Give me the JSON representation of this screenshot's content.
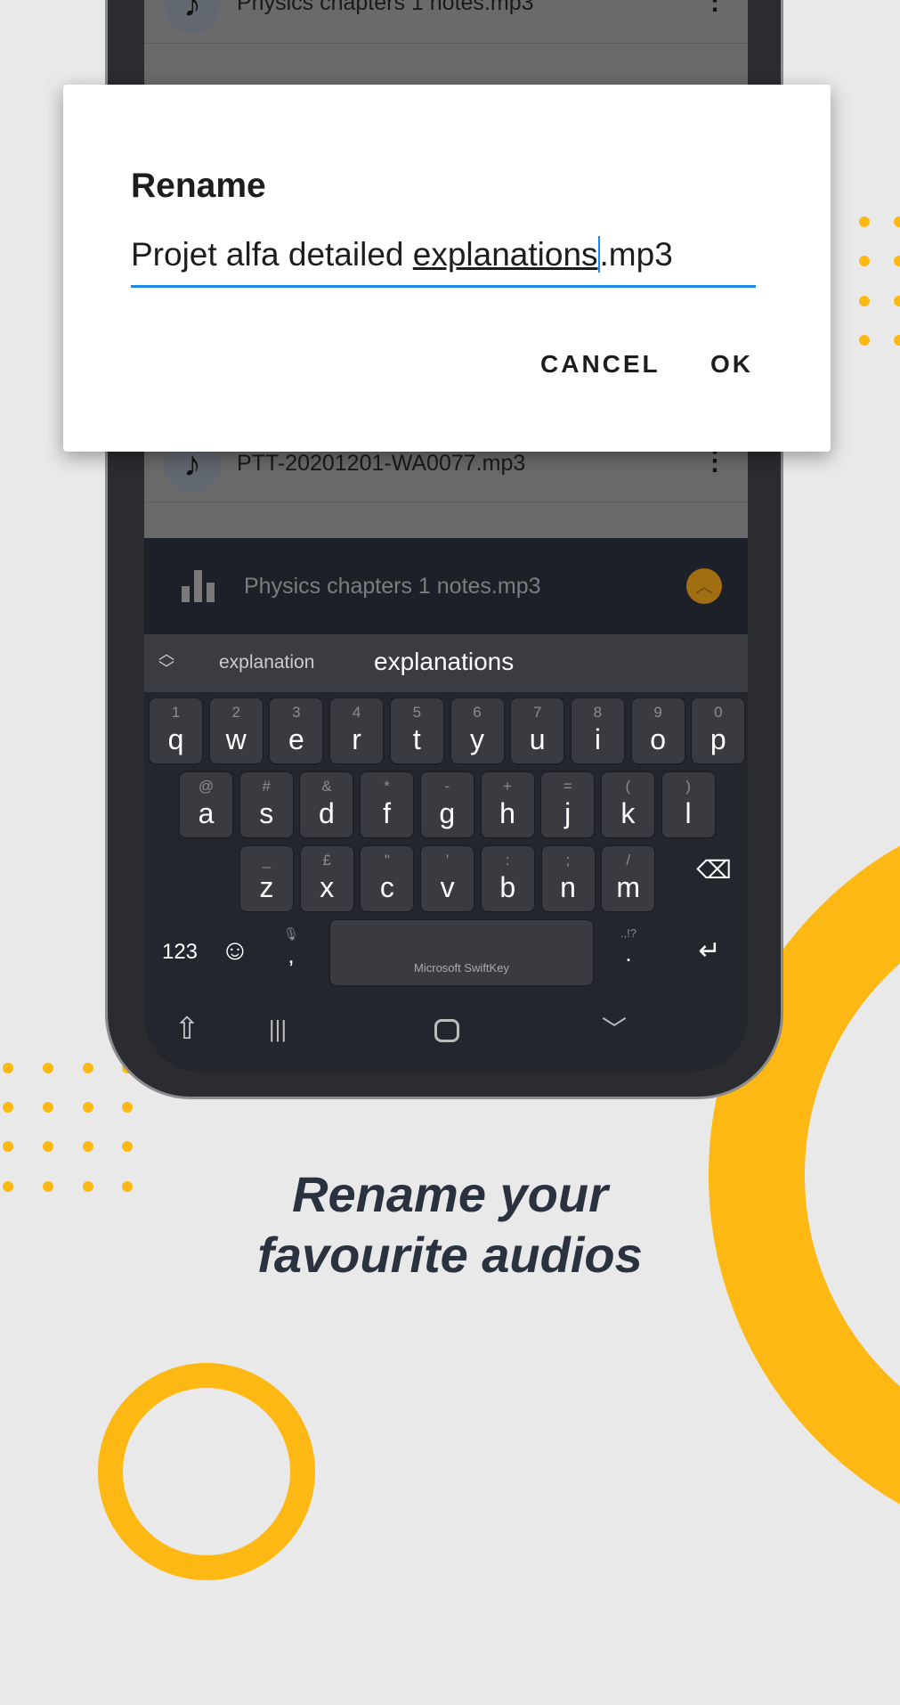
{
  "colors": {
    "accent_yellow": "#fdb813",
    "dialog_underline": "#1e88e5",
    "background": "#e9e9e9"
  },
  "list": {
    "items": [
      {
        "title": "Physics chapters 1 notes.mp3",
        "icon": "music-note-icon"
      },
      {
        "title": "PTT-20201201-WA0077.mp3",
        "icon": "music-note-icon"
      }
    ]
  },
  "player": {
    "title": "Physics chapters 1 notes.mp3",
    "icon": "equalizer-icon",
    "expand_icon": "chevron-up-icon"
  },
  "dialog": {
    "title": "Rename",
    "value_prefix": "Projet alfa detailed ",
    "value_word": "explanations",
    "value_suffix": ".mp3",
    "cancel": "CANCEL",
    "ok": "OK"
  },
  "keyboard": {
    "suggestions": [
      "explanation",
      "explanations"
    ],
    "rows": [
      [
        [
          "q",
          "1"
        ],
        [
          "w",
          "2"
        ],
        [
          "e",
          "3"
        ],
        [
          "r",
          "4"
        ],
        [
          "t",
          "5"
        ],
        [
          "y",
          "6"
        ],
        [
          "u",
          "7"
        ],
        [
          "i",
          "8"
        ],
        [
          "o",
          "9"
        ],
        [
          "p",
          "0"
        ]
      ],
      [
        [
          "a",
          "@"
        ],
        [
          "s",
          "#"
        ],
        [
          "d",
          "&"
        ],
        [
          "f",
          "*"
        ],
        [
          "g",
          "-"
        ],
        [
          "h",
          "+"
        ],
        [
          "j",
          "="
        ],
        [
          "k",
          "("
        ],
        [
          "l",
          ")"
        ]
      ],
      [
        [
          "z",
          "_"
        ],
        [
          "x",
          "£"
        ],
        [
          "c",
          "\""
        ],
        [
          "v",
          "'"
        ],
        [
          "b",
          ":"
        ],
        [
          "n",
          ";"
        ],
        [
          "m",
          "/"
        ]
      ]
    ],
    "numbers_key": "123",
    "comma": ",",
    "period": ".",
    "period_alt": ".,!?",
    "space_label": "Microsoft SwiftKey"
  },
  "tagline": {
    "line1": "Rename your",
    "line2": "favourite audios"
  }
}
